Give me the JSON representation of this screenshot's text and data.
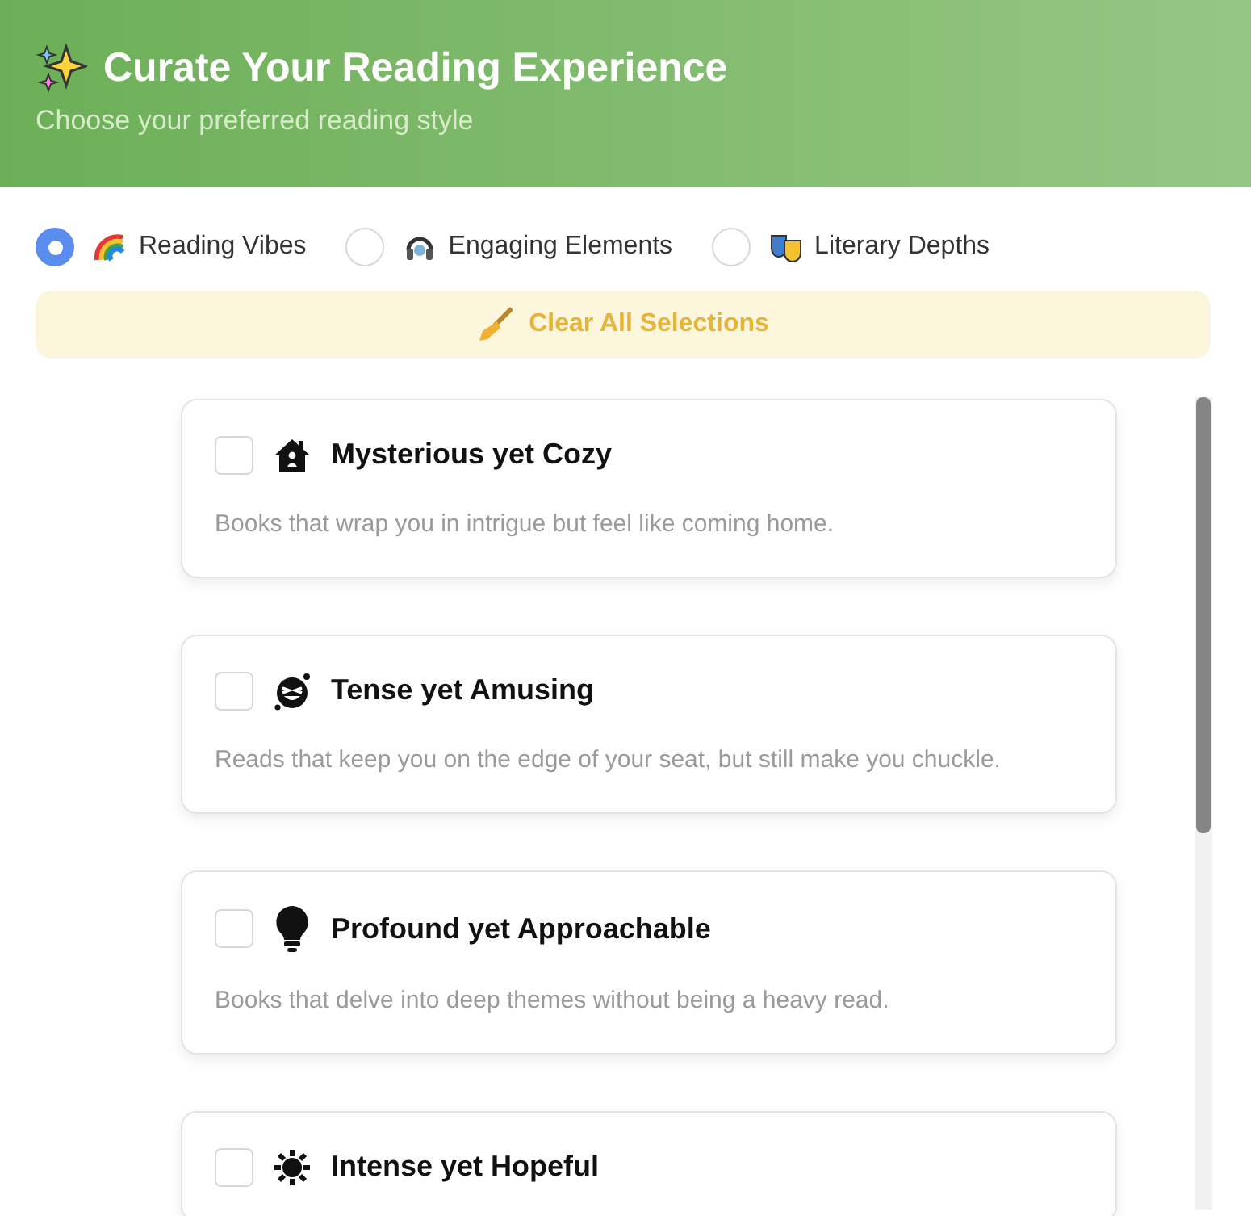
{
  "header": {
    "title": "Curate Your Reading Experience",
    "subtitle": "Choose your preferred reading style"
  },
  "modes": [
    {
      "label": "Reading Vibes",
      "selected": true
    },
    {
      "label": "Engaging Elements",
      "selected": false
    },
    {
      "label": "Literary Depths",
      "selected": false
    }
  ],
  "clear_button": {
    "label": "Clear All Selections"
  },
  "options": [
    {
      "title": "Mysterious yet Cozy",
      "description": "Books that wrap you in intrigue but feel like coming home.",
      "checked": false
    },
    {
      "title": "Tense yet Amusing",
      "description": "Reads that keep you on the edge of your seat, but still make you chuckle.",
      "checked": false
    },
    {
      "title": "Profound yet Approachable",
      "description": "Books that delve into deep themes without being a heavy read.",
      "checked": false
    },
    {
      "title": "Intense yet Hopeful",
      "checked": false
    }
  ]
}
